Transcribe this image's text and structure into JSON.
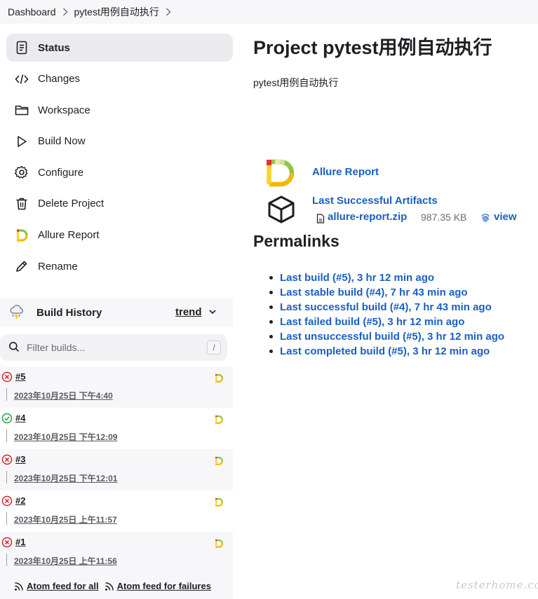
{
  "breadcrumb": {
    "items": [
      "Dashboard",
      "pytest用例自动执行"
    ],
    "separator": "›"
  },
  "sidebar": {
    "items": [
      {
        "label": "Status",
        "icon": "document-icon",
        "active": true
      },
      {
        "label": "Changes",
        "icon": "code-icon"
      },
      {
        "label": "Workspace",
        "icon": "folder-icon"
      },
      {
        "label": "Build Now",
        "icon": "play-icon"
      },
      {
        "label": "Configure",
        "icon": "gear-icon"
      },
      {
        "label": "Delete Project",
        "icon": "trash-icon"
      },
      {
        "label": "Allure Report",
        "icon": "allure-icon"
      },
      {
        "label": "Rename",
        "icon": "pencil-icon"
      }
    ]
  },
  "build_history": {
    "title": "Build History",
    "trend_label": "trend",
    "filter_placeholder": "Filter builds...",
    "shortcut_key": "/",
    "builds": [
      {
        "number": "#5",
        "date": "2023年10月25日 下午4:40",
        "status": "failed"
      },
      {
        "number": "#4",
        "date": "2023年10月25日 下午12:09",
        "status": "success"
      },
      {
        "number": "#3",
        "date": "2023年10月25日 下午12:01",
        "status": "failed"
      },
      {
        "number": "#2",
        "date": "2023年10月25日 上午11:57",
        "status": "failed"
      },
      {
        "number": "#1",
        "date": "2023年10月25日 上午11:56",
        "status": "failed"
      }
    ],
    "feeds": {
      "all": "Atom feed for all",
      "failures": "Atom feed for failures"
    }
  },
  "main": {
    "title": "Project pytest用例自动执行",
    "description": "pytest用例自动执行",
    "allure_report_label": "Allure Report",
    "artifacts": {
      "title": "Last Successful Artifacts",
      "file_name": "allure-report.zip",
      "file_size": "987.35 KB",
      "view_label": "view"
    },
    "permalinks_title": "Permalinks",
    "permalinks": [
      "Last build (#5), 3 hr 12 min ago",
      "Last stable build (#4), 7 hr 43 min ago",
      "Last successful build (#4), 7 hr 43 min ago",
      "Last failed build (#5), 3 hr 12 min ago",
      "Last unsuccessful build (#5), 3 hr 12 min ago",
      "Last completed build (#5), 3 hr 12 min ago"
    ]
  },
  "watermark": "testerhome.com",
  "colors": {
    "link": "#1a5fc2",
    "failed": "#d4262c",
    "success": "#1ea446",
    "active_bg": "#ebebef"
  }
}
